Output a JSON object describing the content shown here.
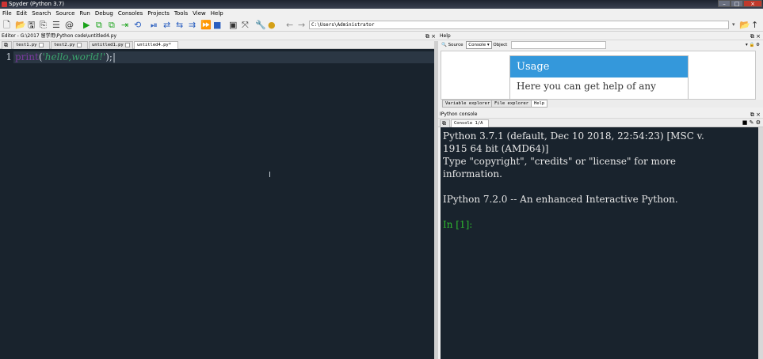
{
  "window": {
    "title": "Spyder (Python 3.7)"
  },
  "menu": [
    "File",
    "Edit",
    "Search",
    "Source",
    "Run",
    "Debug",
    "Consoles",
    "Projects",
    "Tools",
    "View",
    "Help"
  ],
  "toolbar": {
    "path": "C:\\Users\\Administrator"
  },
  "editor": {
    "header": "Editor - G:\\2017 留学用\\Python code\\untitled4.py",
    "tabs": [
      "test1.py",
      "test2.py",
      "untitled1.py",
      "untitled4.py*"
    ],
    "line_number": "1",
    "code": {
      "keyword": "print",
      "open": "(",
      "string": "'hello,world!'",
      "close": ");"
    }
  },
  "help": {
    "header": "Help",
    "source_label": "Source",
    "source_value": "Console",
    "object_label": "Object",
    "usage_title": "Usage",
    "usage_text": "Here you can get help of any",
    "tabs": [
      "Variable explorer",
      "File explorer",
      "Help"
    ]
  },
  "ipython": {
    "header": "IPython console",
    "tab": "Console 1/A",
    "lines": [
      "Python 3.7.1 (default, Dec 10 2018, 22:54:23) [MSC v.",
      "1915 64 bit (AMD64)]",
      "Type \"copyright\", \"credits\" or \"license\" for more",
      "information.",
      "",
      "IPython 7.2.0 -- An enhanced Interactive Python.",
      ""
    ],
    "prompt": "In [1]:"
  }
}
